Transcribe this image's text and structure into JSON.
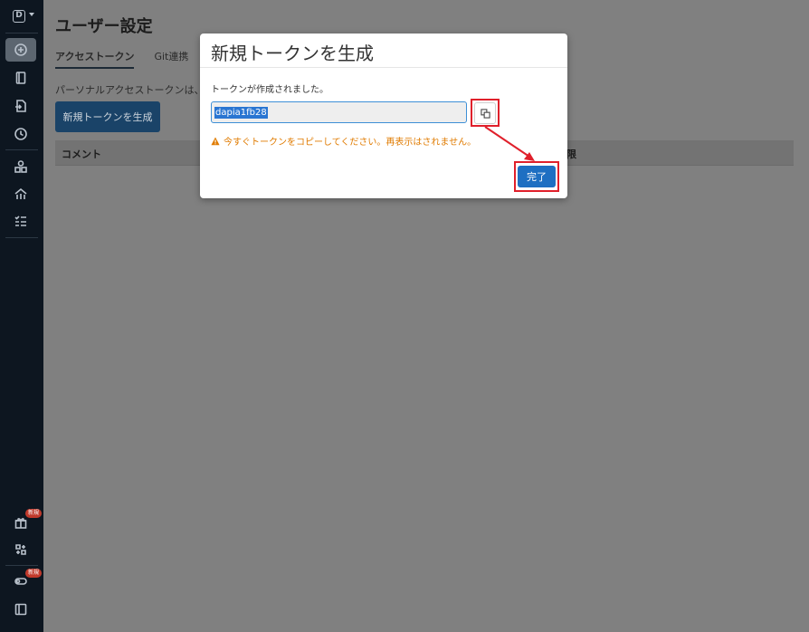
{
  "sidebar": {
    "logo_letter": "D",
    "items": [
      {
        "name": "sidebar-item-home",
        "icon": "plus-circle-icon",
        "active": true
      },
      {
        "name": "sidebar-item-notebook",
        "icon": "notebook-icon"
      },
      {
        "name": "sidebar-item-import",
        "icon": "file-import-icon"
      },
      {
        "name": "sidebar-item-history",
        "icon": "clock-icon"
      },
      {
        "name": "sidebar-item-shapes",
        "icon": "shapes-icon"
      },
      {
        "name": "sidebar-item-network",
        "icon": "network-icon"
      },
      {
        "name": "sidebar-item-tasks",
        "icon": "checklist-icon"
      }
    ],
    "bottom_items": [
      {
        "name": "sidebar-item-gift",
        "icon": "gift-icon",
        "badge": "新規"
      },
      {
        "name": "sidebar-item-integrations",
        "icon": "puzzle-icon"
      },
      {
        "name": "sidebar-item-toggle",
        "icon": "toggle-icon",
        "badge": "新規"
      },
      {
        "name": "sidebar-item-collapse",
        "icon": "sidebar-collapse-icon"
      }
    ]
  },
  "page": {
    "title": "ユーザー設定",
    "tabs": [
      {
        "label": "アクセストークン",
        "active": true
      },
      {
        "label": "Git連携",
        "active": false
      }
    ],
    "description": "パーソナルアクセストークンは、",
    "new_token_button": "新規トークンを生成",
    "table_headers": [
      "コメント",
      "限"
    ]
  },
  "modal": {
    "title": "新規トークンを生成",
    "created_message": "トークンが作成されました。",
    "token_value": "dapia1fb28",
    "warning": "今すぐトークンをコピーしてください。再表示はされません。",
    "done_button": "完了"
  },
  "colors": {
    "accent": "#1e6fc2",
    "warning": "#e07b00",
    "highlight": "#e0202b",
    "sidebar_bg": "#0d1620"
  }
}
